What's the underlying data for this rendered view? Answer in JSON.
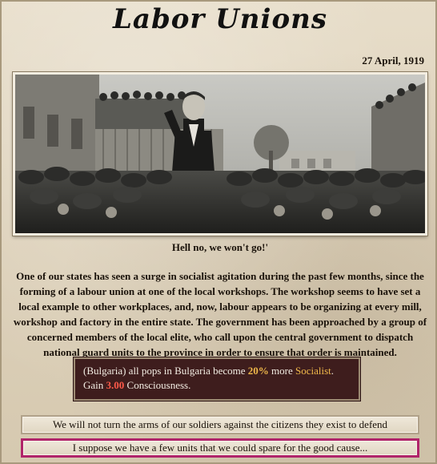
{
  "event": {
    "title": "Labor Unions",
    "date": "27 April, 1919",
    "caption": "Hell no, we won't go!'",
    "description": "One of our states has seen a surge in socialist agitation during the past few months, since the forming of a labour union at one of the local workshops. The workshop seems to have set a local example to other workplaces, and, now, labour appears to be organizing at every mill, workshop and factory in the entire state. The government has been approached by a group of concerned members of the local elite, who call upon the central government to dispatch national guard units to the province in order to ensure that order is maintained."
  },
  "effects": {
    "line1_prefix": "(Bulgaria) all pops in Bulgaria become ",
    "line1_percent": "20%",
    "line1_mid": " more ",
    "line1_ideology": "Socialist",
    "line1_suffix": ".",
    "line2_prefix": "Gain ",
    "line2_value": "3.00",
    "line2_suffix": " Consciousness.",
    "colors": {
      "highlight": "#f0b84a",
      "negative": "#ff5a4a",
      "box": "#3e1d1d"
    }
  },
  "options": [
    {
      "label": "We will not turn the arms of our soldiers against the citizens they exist to defend"
    },
    {
      "label": "I suppose we have a few units that we could spare for the good cause..."
    }
  ]
}
